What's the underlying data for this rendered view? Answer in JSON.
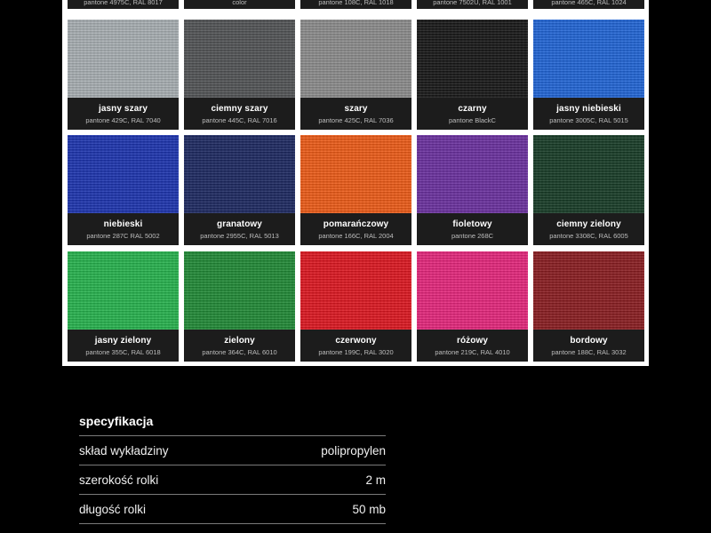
{
  "swatches": [
    {
      "name": "",
      "pantone": "pantone 4975C, RAL 8017",
      "color": "#3a2a22",
      "top": true
    },
    {
      "name": "",
      "pantone": "color",
      "color": "#3a3a3a",
      "top": true
    },
    {
      "name": "",
      "pantone": "pantone 108C, RAL 1018",
      "color": "#e8c400",
      "top": true
    },
    {
      "name": "",
      "pantone": "pantone 7502U, RAL 1001",
      "color": "#cdb48a",
      "top": true
    },
    {
      "name": "",
      "pantone": "pantone 465C, RAL 1024",
      "color": "#a88a4a",
      "top": true
    },
    {
      "name": "jasny szary",
      "pantone": "pantone 429C, RAL 7040",
      "color": "#a9b0b4"
    },
    {
      "name": "ciemny szary",
      "pantone": "pantone 445C, RAL 7016",
      "color": "#505254"
    },
    {
      "name": "szary",
      "pantone": "pantone 425C, RAL 7036",
      "color": "#8c8c8c"
    },
    {
      "name": "czarny",
      "pantone": "pantone BlackC",
      "color": "#141414"
    },
    {
      "name": "jasny niebieski",
      "pantone": "pantone 3005C, RAL 5015",
      "color": "#1e64d8"
    },
    {
      "name": "niebieski",
      "pantone": "pantone 287C RAL 5002",
      "color": "#1a32b0"
    },
    {
      "name": "granatowy",
      "pantone": "pantone 2955C, RAL 5013",
      "color": "#1a2660"
    },
    {
      "name": "pomarańczowy",
      "pantone": "pantone 166C, RAL 2004",
      "color": "#f05a14"
    },
    {
      "name": "fioletowy",
      "pantone": "pantone 268C",
      "color": "#6a2ea0"
    },
    {
      "name": "ciemny zielony",
      "pantone": "pantone 3308C, RAL 6005",
      "color": "#143a24"
    },
    {
      "name": "jasny zielony",
      "pantone": "pantone 355C, RAL 6018",
      "color": "#24b44c"
    },
    {
      "name": "zielony",
      "pantone": "pantone 364C, RAL 6010",
      "color": "#1e8a34"
    },
    {
      "name": "czerwony",
      "pantone": "pantone 199C, RAL 3020",
      "color": "#e0141e"
    },
    {
      "name": "różowy",
      "pantone": "pantone 219C, RAL 4010",
      "color": "#e8247c"
    },
    {
      "name": "bordowy",
      "pantone": "pantone 188C, RAL 3032",
      "color": "#8a1a1e"
    }
  ],
  "spec": {
    "title": "specyfikacja",
    "rows": [
      {
        "label": "skład wykładziny",
        "value": "polipropylen"
      },
      {
        "label": "szerokość rolki",
        "value": "2 m"
      },
      {
        "label": "długość rolki",
        "value": "50 mb"
      }
    ]
  }
}
